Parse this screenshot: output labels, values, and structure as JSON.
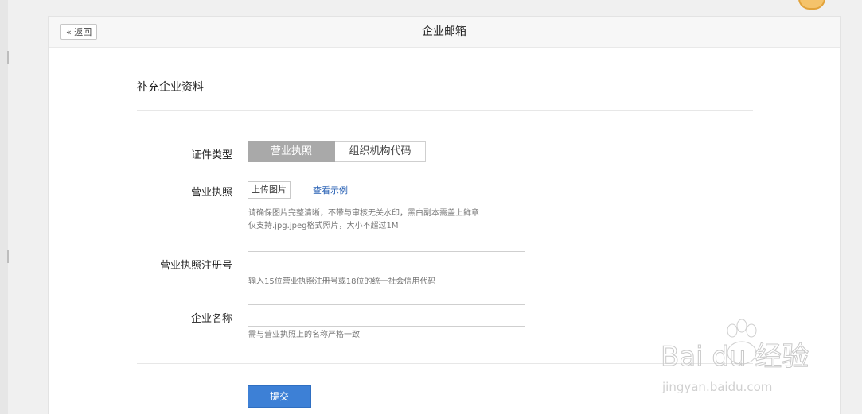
{
  "header": {
    "back_label": "« 返回",
    "title": "企业邮箱"
  },
  "section": {
    "title": "补充企业资料"
  },
  "form": {
    "cert_type": {
      "label": "证件类型",
      "options": [
        "营业执照",
        "组织机构代码"
      ],
      "selected": "营业执照"
    },
    "license": {
      "label": "营业执照",
      "upload_label": "上传图片",
      "example_link": "查看示例",
      "hints": [
        "请确保图片完整清晰，不带与审核无关水印，黑白副本需盖上鲜章",
        "仅支持.jpg.jpeg格式照片，大小不超过1M"
      ]
    },
    "reg_number": {
      "label": "营业执照注册号",
      "value": "",
      "placeholder": "",
      "hint": "输入15位营业执照注册号或18位的统一社会信用代码"
    },
    "company_name": {
      "label": "企业名称",
      "value": "",
      "placeholder": "",
      "hint": "需与营业执照上的名称严格一致"
    },
    "submit_label": "提交"
  },
  "watermark": {
    "brand": "Bai du 经验",
    "url": "jingyan.baidu.com"
  },
  "colors": {
    "primary": "#3d80d6",
    "link": "#2a62b5",
    "segment_active": "#a9a9a9"
  }
}
